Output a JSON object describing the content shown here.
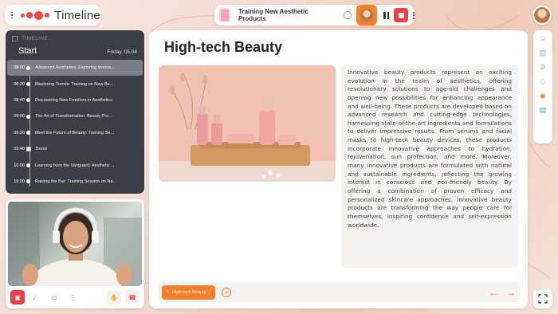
{
  "brand": {
    "title": "Timeline"
  },
  "session": {
    "title": "Training New Aesthetic Products"
  },
  "timeline": {
    "header": "TIMELINE",
    "start_label": "Start",
    "day": "Friday, 05.04",
    "items": [
      {
        "time": "08:00",
        "title": "Advanced Aesthetics: Exploring Innova...",
        "active": true
      },
      {
        "time": "08:20",
        "title": "Mastering Trends: Training on New Be..."
      },
      {
        "time": "08:40",
        "title": "Discovering New Frontiers in Aesthetics"
      },
      {
        "time": "09:00",
        "title": "The Art of Transformation: Beauty Pro..."
      },
      {
        "time": "09:20",
        "title": "Meet the Future of Beauty: Training Se..."
      },
      {
        "time": "09:40",
        "title": "Break",
        "is_break": true
      },
      {
        "time": "10:00",
        "title": "Learning from the Vanguard: Aesthetic ..."
      },
      {
        "time": "10:20",
        "title": "Raising the Bar: Training Session on Ne..."
      }
    ]
  },
  "main": {
    "title": "High-tech Beauty",
    "body": "Innovative beauty products represent an exciting evolution in the realm of aesthetics, offering revolutionary solutions to age-old challenges and opening new possibilities for enhancing appearance and well-being. These products are developed based on advanced research and cutting-edge technologies, harnessing state-of-the-art ingredients and formulations to deliver impressive results. From serums and facial masks to high-tech beauty devices, these products incorporate innovative approaches to hydration, rejuvenation, sun protection, and more. Moreover, many innovative products are formulated with natural and sustainable ingredients, reflecting the growing interest in conscious and eco-friendly beauty. By offering a combination of proven efficacy and personalized skincare approaches, innovative beauty products are transforming the way people care for themselves, inspiring confidence and self-expression worldwide.",
    "slide_tab": {
      "number": "1",
      "label": "High-tech Beauty"
    },
    "add_symbol": "+",
    "prev_symbol": "←",
    "next_symbol": "→"
  },
  "video_controls": {
    "icons": [
      "camera-off-icon",
      "microphone-icon",
      "screen-share-icon",
      "more-vertical-icon",
      "raise-hand-icon",
      "hang-up-icon"
    ]
  },
  "rail": {
    "icons": [
      "participants-icon",
      "image-icon",
      "eye-off-icon",
      "location-icon",
      "leaf-icon",
      "expand-icon"
    ]
  },
  "colors": {
    "accent": "#f57f2a",
    "danger": "#ef3d45",
    "panel_dark": "#3b3f44",
    "success": "#2fbf5c"
  }
}
